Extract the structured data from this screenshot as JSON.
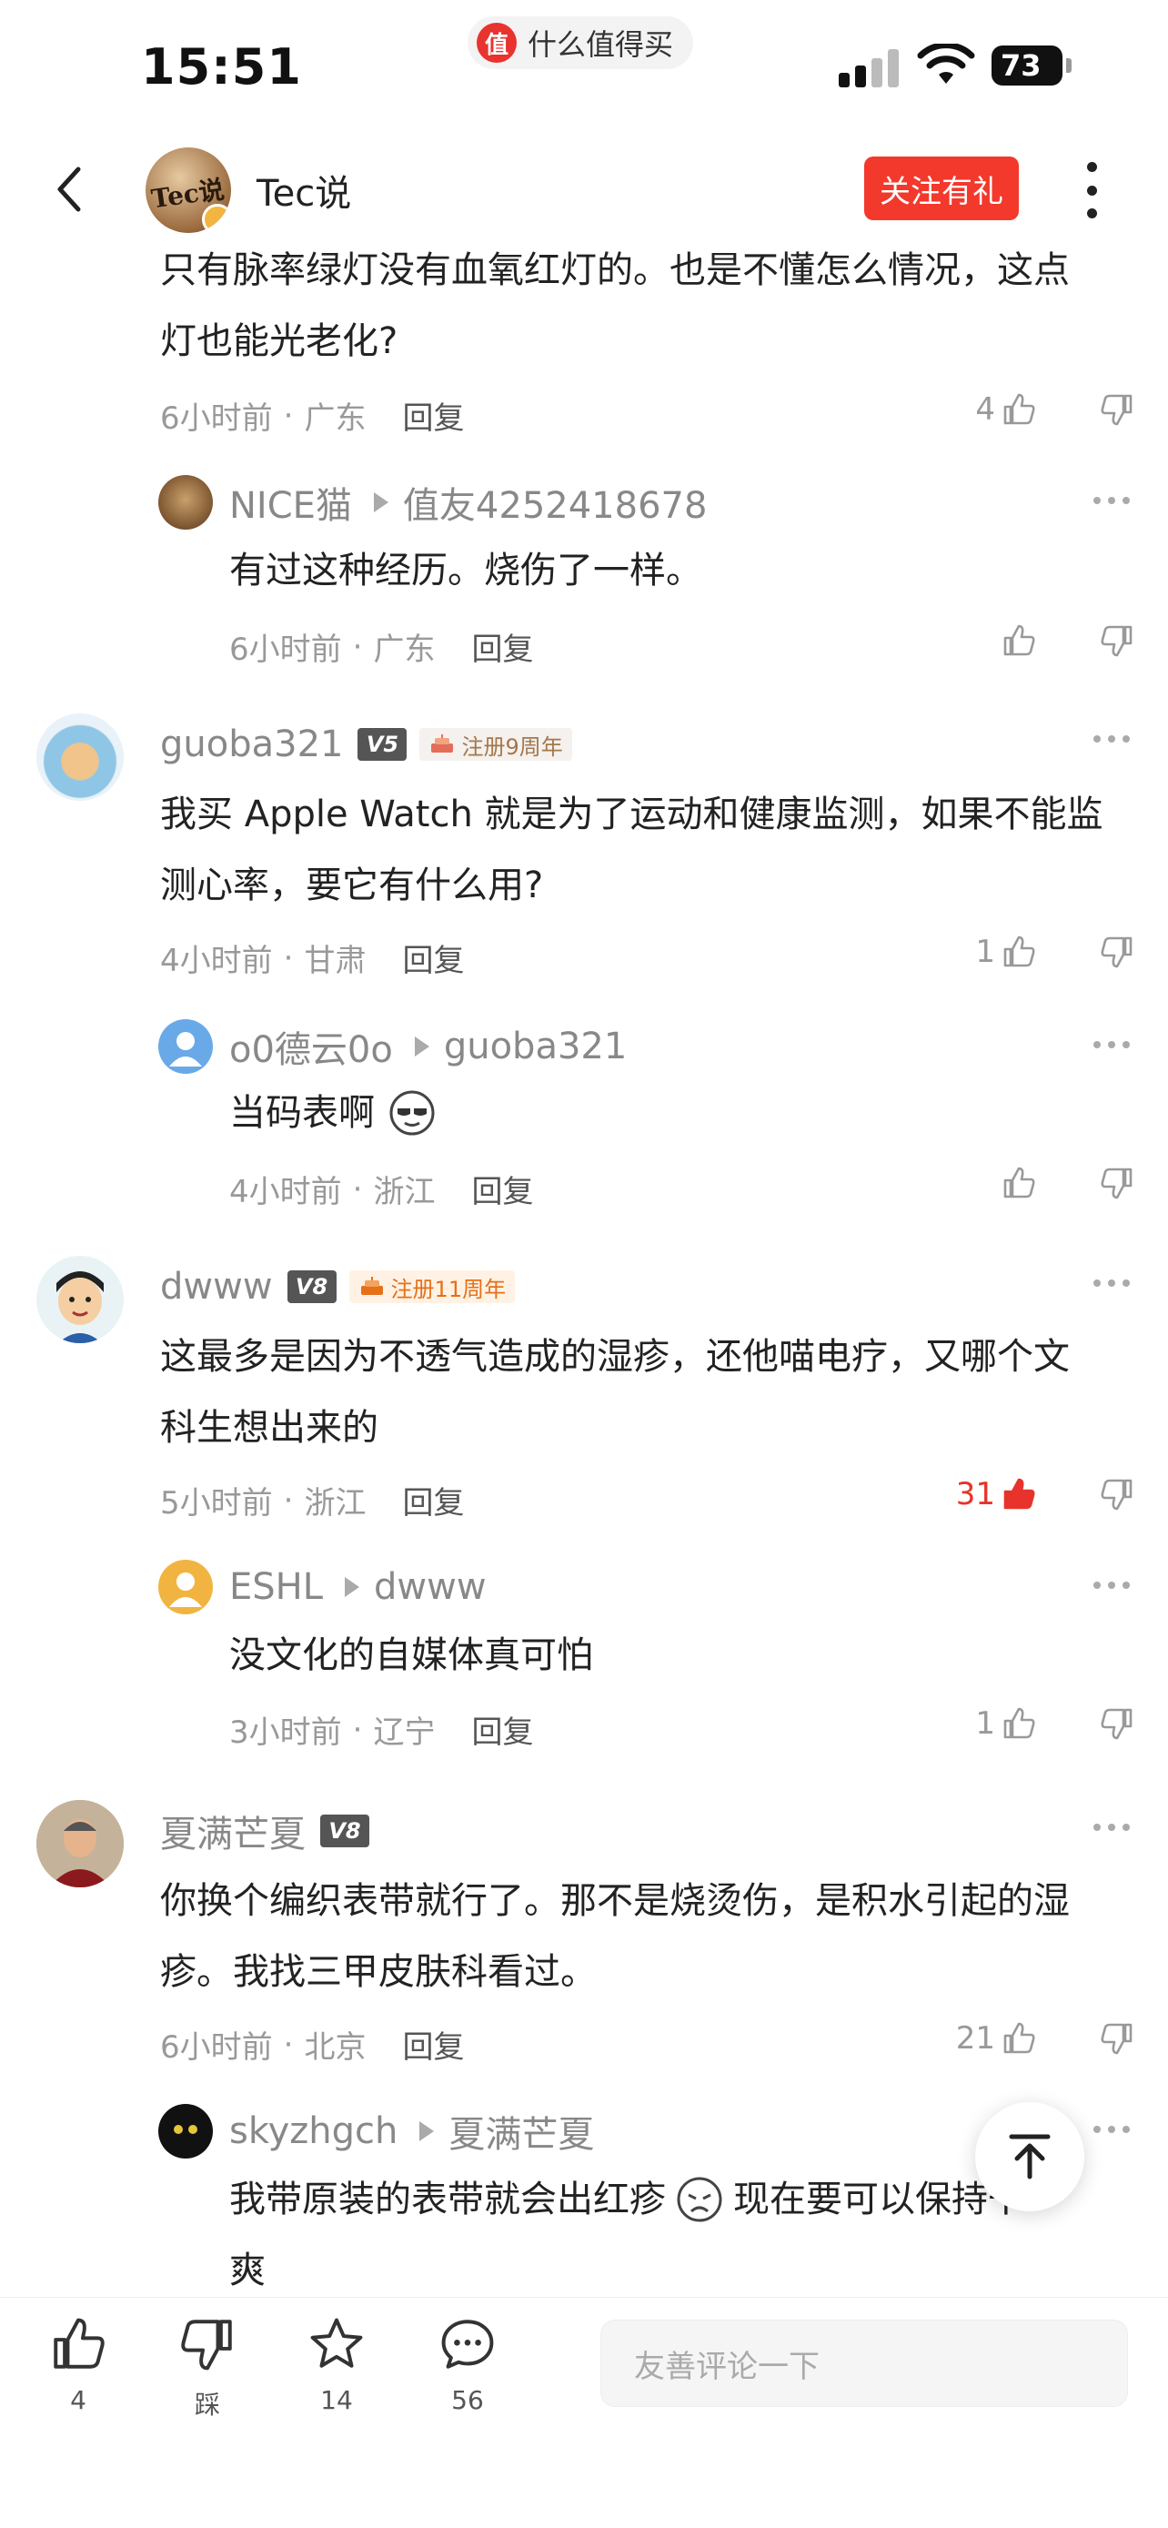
{
  "status_bar": {
    "time": "15:51",
    "app_name": "什么值得买",
    "app_logo_char": "值",
    "battery": "73"
  },
  "header": {
    "author": "Tec说",
    "follow_label": "关注有礼",
    "avatar_text": "Tec说"
  },
  "comments": [
    {
      "text_line1": "只有脉率绿灯没有血氧红灯的。也是不懂怎么情况，这点",
      "text_line2": "灯也能光老化?",
      "time": "6小时前",
      "region": "广东",
      "reply": "回复",
      "likes": "4"
    },
    {
      "user": "NICE猫",
      "reply_to": "值友4252418678",
      "text": "有过这种经历。烧伤了一样。",
      "time": "6小时前",
      "region": "广东",
      "reply": "回复",
      "likes": ""
    },
    {
      "user": "guoba321",
      "level": "V5",
      "badge": "注册9周年",
      "text_line1": "我买 Apple Watch 就是为了运动和健康监测，如果不能监",
      "text_line2": "测心率，要它有什么用?",
      "time": "4小时前",
      "region": "甘肃",
      "reply": "回复",
      "likes": "1"
    },
    {
      "user": "o0德云0o",
      "reply_to": "guoba321",
      "text": "当码表啊",
      "time": "4小时前",
      "region": "浙江",
      "reply": "回复",
      "likes": ""
    },
    {
      "user": "dwww",
      "level": "V8",
      "badge": "注册11周年",
      "text_line1": "这最多是因为不透气造成的湿疹，还他喵电疗，又哪个文",
      "text_line2": "科生想出来的",
      "time": "5小时前",
      "region": "浙江",
      "reply": "回复",
      "likes": "31"
    },
    {
      "user": "ESHL",
      "reply_to": "dwww",
      "text": "没文化的自媒体真可怕",
      "time": "3小时前",
      "region": "辽宁",
      "reply": "回复",
      "likes": "1"
    },
    {
      "user": "夏满芒夏",
      "level": "V8",
      "text_line1": "你换个编织表带就行了。那不是烧烫伤，是积水引起的湿",
      "text_line2": "疹。我找三甲皮肤科看过。",
      "time": "6小时前",
      "region": "北京",
      "reply": "回复",
      "likes": "21"
    },
    {
      "user": "skyzhgch",
      "reply_to": "夏满芒夏",
      "text_a": "我带原装的表带就会出红疹",
      "text_b": "现在要可以保持干",
      "text_line2": "爽"
    }
  ],
  "meta_sep": "·",
  "bottom_bar": {
    "like_count": "4",
    "dislike_label": "踩",
    "fav_count": "14",
    "comment_count": "56",
    "input_placeholder": "友善评论一下"
  },
  "colors": {
    "accent": "#f3382c",
    "hot_like": "#e7332b",
    "muted": "#999999"
  }
}
